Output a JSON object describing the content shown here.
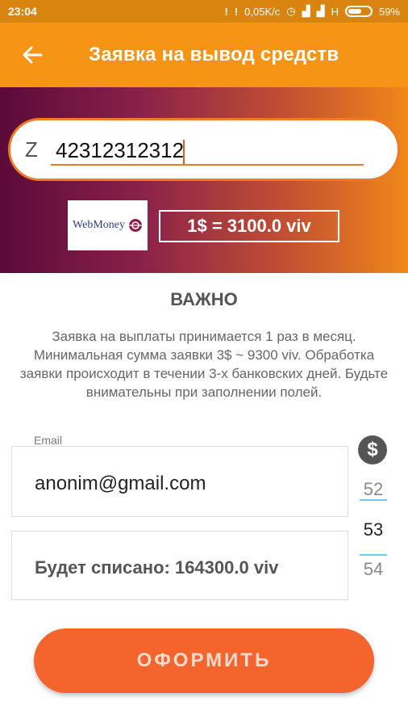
{
  "status_bar": {
    "time": "23:04",
    "speed": "0,05K/c",
    "network": "H",
    "battery": "59%"
  },
  "app_bar": {
    "title": "Заявка на вывод средств"
  },
  "wallet": {
    "prefix": "Z",
    "value": "42312312312"
  },
  "payment": {
    "logo_text": "WebMoney",
    "rate": "1$ = 3100.0 viv"
  },
  "important": {
    "title": "ВАЖНО",
    "text": "Заявка на выплаты принимается 1 раз в месяц. Минимальная сумма заявки 3$ ~ 9300 viv. Обработка заявки происходит в течении 3-х банковских дней. Будьте внимательны при заполнении полей."
  },
  "form": {
    "email_label": "Email",
    "email_value": "anonim@gmail.com",
    "charge_text": "Будет списано: 164300.0 viv"
  },
  "amount_picker": {
    "items": [
      "52",
      "53",
      "54"
    ],
    "selected": "53"
  },
  "submit_label": "ОФОРМИТЬ",
  "colors": {
    "app_bar": "#f59415",
    "accent": "#f4652d",
    "picker_line": "#7ac8e6"
  }
}
